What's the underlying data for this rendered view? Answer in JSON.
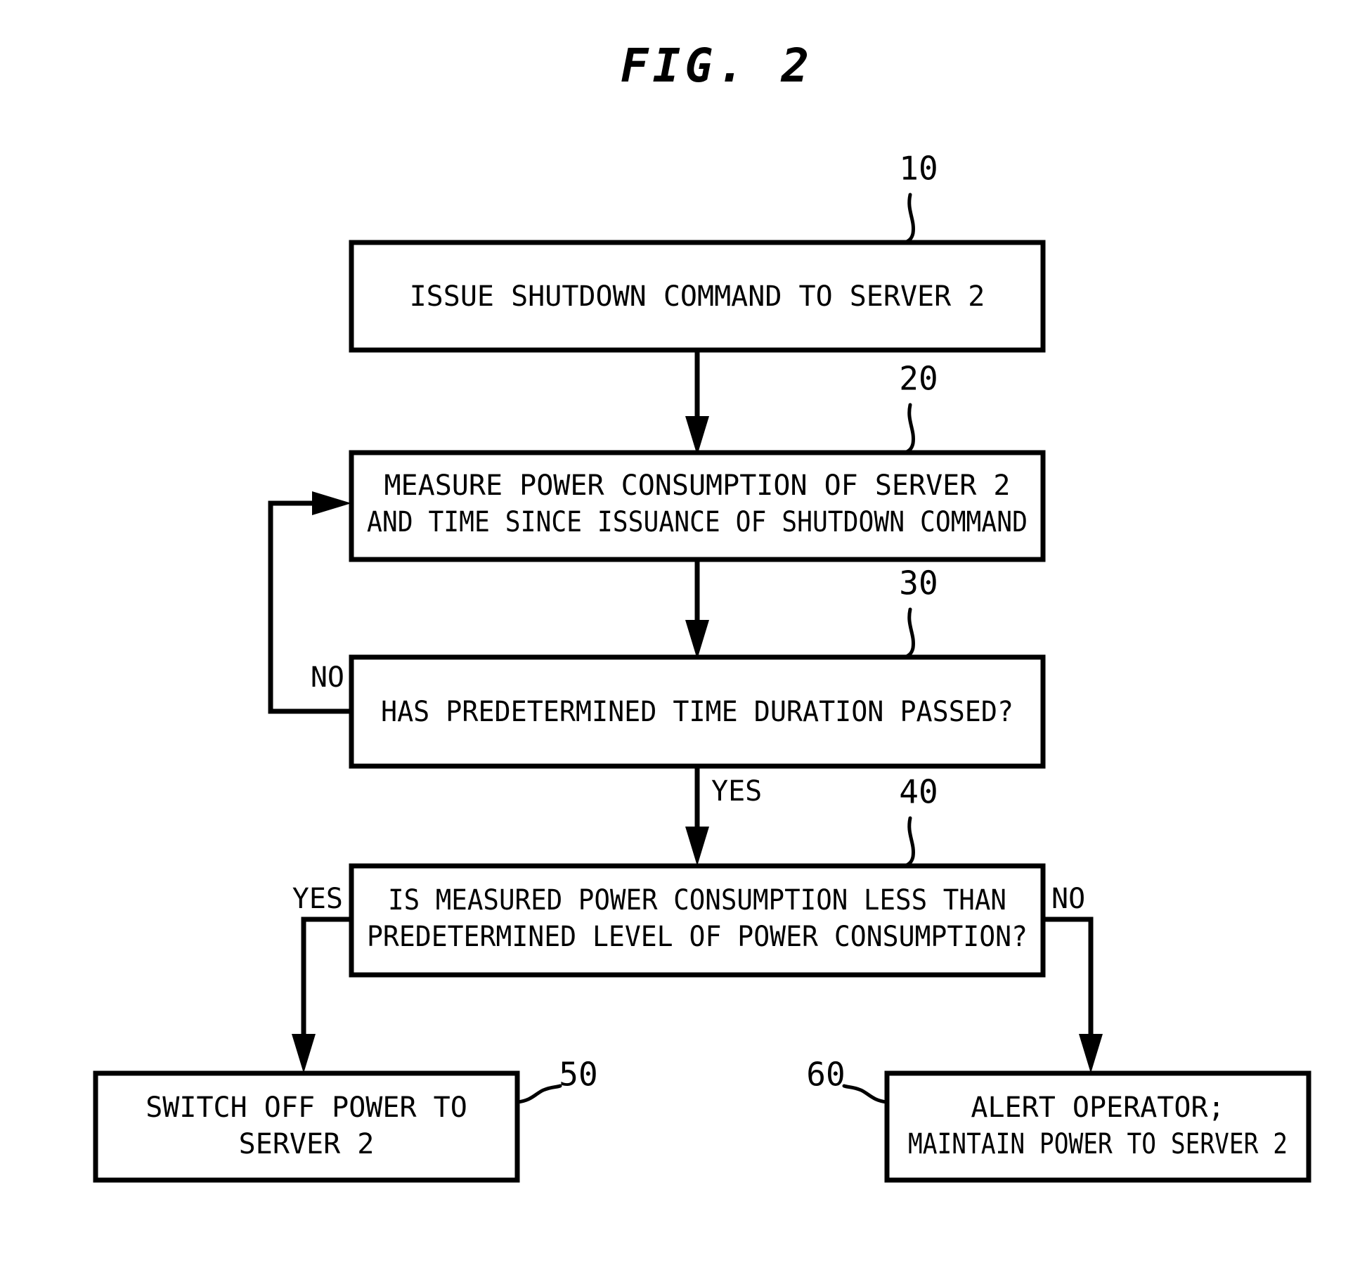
{
  "figure": {
    "title": "FIG. 2",
    "type": "patent-flowchart"
  },
  "nodes": [
    {
      "ref": "10",
      "name": "issue-shutdown-command",
      "lines": [
        "ISSUE SHUTDOWN COMMAND TO SERVER 2"
      ]
    },
    {
      "ref": "20",
      "name": "measure-power-and-time",
      "lines": [
        "MEASURE POWER CONSUMPTION OF SERVER 2",
        "AND TIME SINCE ISSUANCE OF SHUTDOWN COMMAND"
      ]
    },
    {
      "ref": "30",
      "name": "time-duration-decision",
      "lines": [
        "HAS PREDETERMINED TIME DURATION PASSED?"
      ]
    },
    {
      "ref": "40",
      "name": "power-level-decision",
      "lines": [
        "IS MEASURED POWER CONSUMPTION LESS THAN",
        "PREDETERMINED LEVEL OF POWER CONSUMPTION?"
      ]
    },
    {
      "ref": "50",
      "name": "switch-off-power",
      "lines": [
        "SWITCH OFF POWER TO",
        "SERVER 2"
      ]
    },
    {
      "ref": "60",
      "name": "alert-operator",
      "lines": [
        "ALERT OPERATOR;",
        "MAINTAIN POWER TO SERVER 2"
      ]
    }
  ],
  "branch_labels": {
    "loop_no": "NO",
    "time_yes": "YES",
    "power_yes": "YES",
    "power_no": "NO"
  },
  "colors": {
    "ink": "#000000",
    "paper": "#ffffff"
  }
}
